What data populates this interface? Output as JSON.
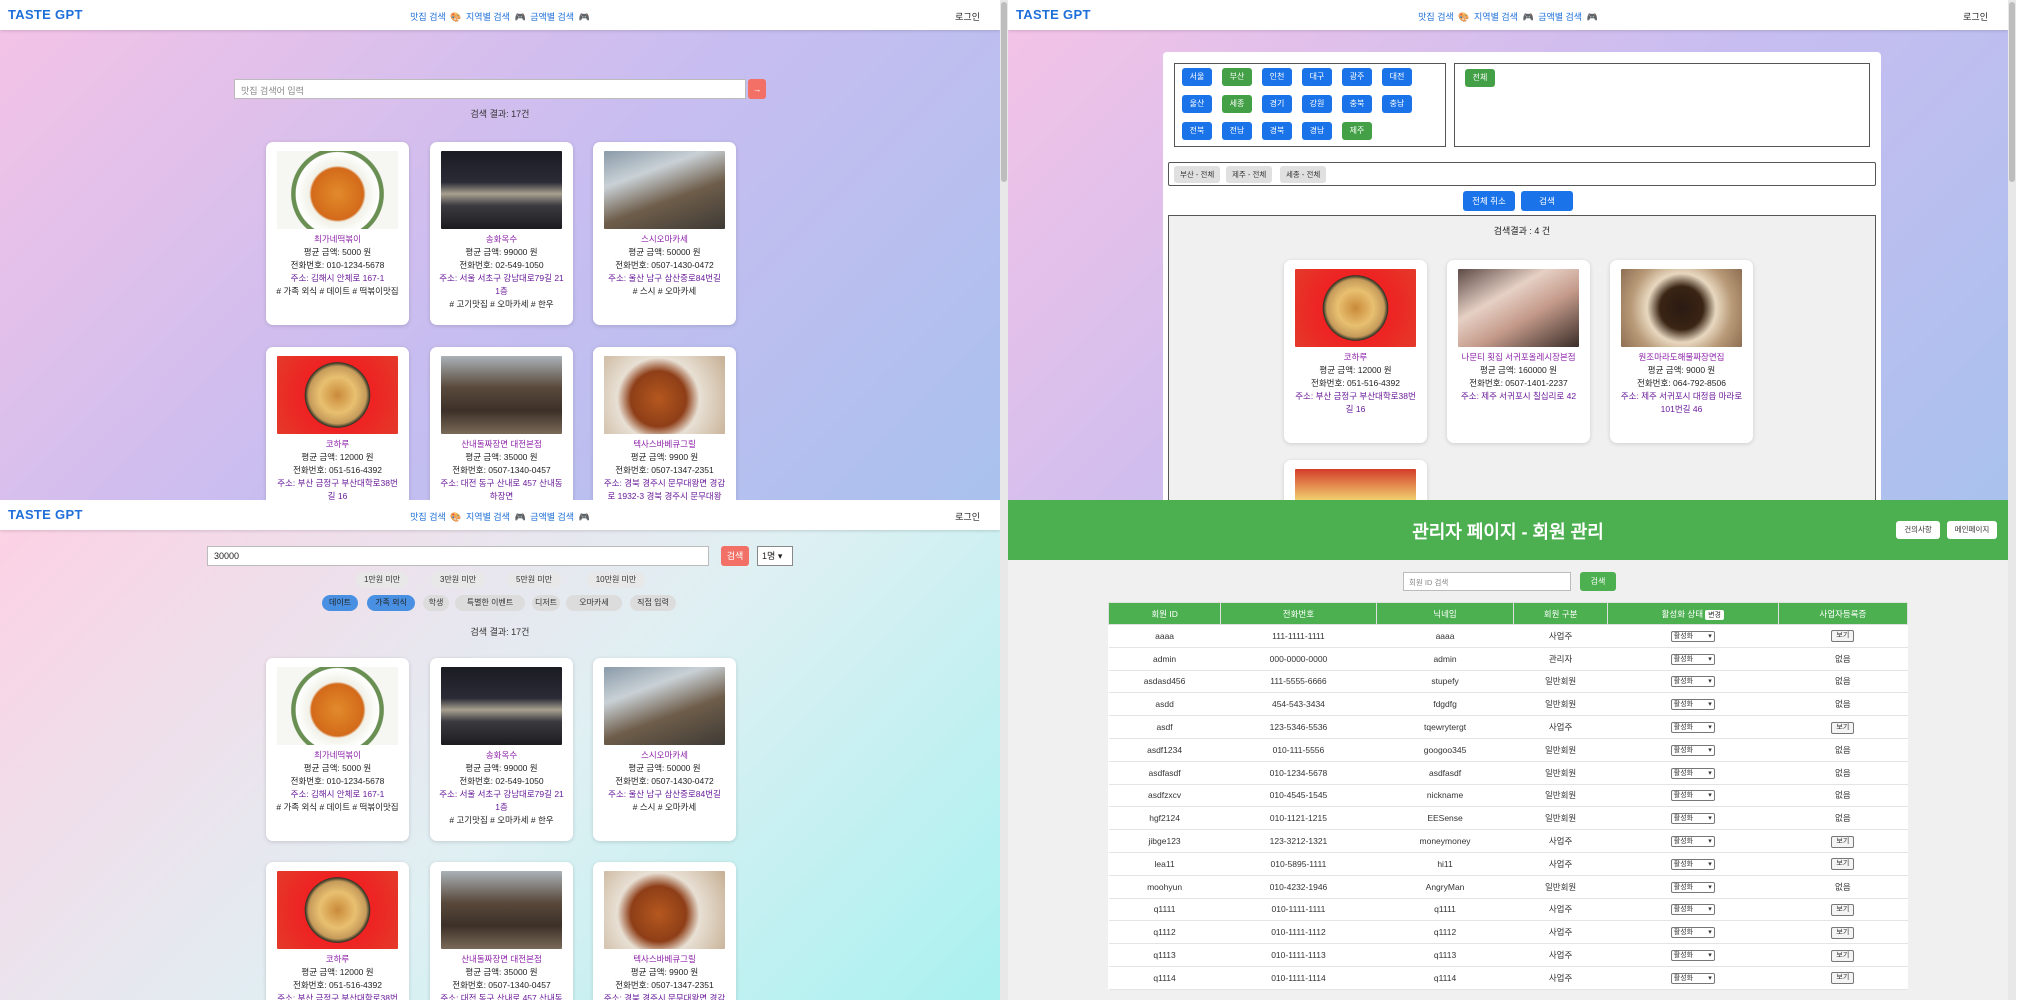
{
  "header": {
    "logo": "TASTE GPT",
    "nav": [
      "맛집 검색",
      "🎨",
      "지역별 검색",
      "🎮",
      "금액별 검색",
      "🎮"
    ],
    "login": "로그인"
  },
  "q1": {
    "search_placeholder": "맛집 검색어 입력",
    "go": "→",
    "count": "검색 결과: 17건"
  },
  "restaurants": [
    {
      "name": "최가네떡볶이",
      "price": "평균 금액: 5000 원",
      "phone": "전화번호: 010-1234-5678",
      "addr": "주소: 김해시 안체로 167-1",
      "tags": "# 가족 외식 # 데이트 # 떡볶이맛집",
      "img": "food1"
    },
    {
      "name": "송화옥수",
      "price": "평균 금액: 99000 원",
      "phone": "전화번호: 02-549-1050",
      "addr": "주소: 서울 서초구 강남대로79길 21 1층",
      "tags": "# 고기맛집 # 오마카세 # 한우",
      "img": "bldg"
    },
    {
      "name": "스시오마카세",
      "price": "평균 금액: 50000 원",
      "phone": "전화번호: 0507-1430-0472",
      "addr": "주소: 울산 남구 삼산중로84번길",
      "tags": "# 스시 # 오마카세",
      "img": "rest"
    },
    {
      "name": "코하루",
      "price": "평균 금액: 12000 원",
      "phone": "전화번호: 051-516-4392",
      "addr": "주소: 부산 금정구 부산대학로38번길 16",
      "tags": "",
      "img": "ramen"
    },
    {
      "name": "산내돌짜장면 대전본점",
      "price": "평균 금액: 35000 원",
      "phone": "전화번호: 0507-1340-0457",
      "addr": "주소: 대전 동구 산내로 457 산내동하장면",
      "tags": "",
      "img": "people"
    },
    {
      "name": "텍사스바베큐그릴",
      "price": "평균 금액: 9900 원",
      "phone": "전화번호: 0507-1347-2351",
      "addr": "주소: 경북 경주시 문무대왕면 경감로 1932-3 경북 경주시 문무대왕",
      "tags": "",
      "img": "meat"
    }
  ],
  "q2": {
    "regions": [
      "서울",
      "부산",
      "인천",
      "대구",
      "광주",
      "대전",
      "울산",
      "세종",
      "경기",
      "강원",
      "충북",
      "충남",
      "전북",
      "전남",
      "경북",
      "경남",
      "제주"
    ],
    "region_selected": [
      "부산",
      "세종",
      "제주"
    ],
    "sub_all": "전체",
    "chips": [
      "부산 - 전체",
      "제주 - 전체",
      "세종 - 전체"
    ],
    "cancel_all": "전체 취소",
    "search": "검색",
    "count": "검색결과 : 4 건",
    "results": [
      {
        "name": "코하루",
        "price": "평균 금액: 12000 원",
        "phone": "전화번호: 051-516-4392",
        "addr": "주소: 부산 금정구 부산대학로38번길 16",
        "img": "ramen"
      },
      {
        "name": "나문티 횟집 서귀포올레시장본점",
        "price": "평균 금액: 160000 원",
        "phone": "전화번호: 0507-1401-2237",
        "addr": "주소: 제주 서귀포시 칠십리로 42",
        "img": "sashimi"
      },
      {
        "name": "원조마라도해물짜장면집",
        "price": "평균 금액: 9000 원",
        "phone": "전화번호: 064-792-8506",
        "addr": "주소: 제주 서귀포시 대정읍 마라로101번길 46",
        "img": "jjajang"
      }
    ]
  },
  "q3": {
    "search_value": "30000",
    "search": "검색",
    "people": "1명",
    "price_filters": [
      "1만원 미만",
      "3만원 미만",
      "5만원 미만",
      "10만원 미만"
    ],
    "tags": [
      "데이트",
      "가족 외식",
      "학생",
      "특별한 이벤트",
      "디저트",
      "오마카세",
      "직접 입력"
    ],
    "tags_active": [
      "데이트",
      "가족 외식"
    ],
    "count": "검색 결과: 17건"
  },
  "admin": {
    "title": "관리자 페이지 - 회원 관리",
    "btn_notice": "건의사항",
    "btn_main": "메인페이지",
    "search_placeholder": "회원 ID 검색",
    "search": "검색",
    "columns": [
      "회원 ID",
      "전화번호",
      "닉네임",
      "회원 구분",
      "활성화 상태",
      "사업자등록증"
    ],
    "edit": "변경",
    "rows": [
      [
        "aaaa",
        "111-1111-1111",
        "aaaa",
        "사업주",
        "활성화",
        "보기"
      ],
      [
        "admin",
        "000-0000-0000",
        "admin",
        "관리자",
        "활성화",
        "없음"
      ],
      [
        "asdasd456",
        "111-5555-6666",
        "stupefy",
        "일반회원",
        "활성화",
        "없음"
      ],
      [
        "asdd",
        "454-543-3434",
        "fdgdfg",
        "일반회원",
        "활성화",
        "없음"
      ],
      [
        "asdf",
        "123-5346-5536",
        "tqewrytergt",
        "사업주",
        "활성화",
        "보기"
      ],
      [
        "asdf1234",
        "010-111-5556",
        "googoo345",
        "일반회원",
        "활성화",
        "없음"
      ],
      [
        "asdfasdf",
        "010-1234-5678",
        "asdfasdf",
        "일반회원",
        "활성화",
        "없음"
      ],
      [
        "asdfzxcv",
        "010-4545-1545",
        "nickname",
        "일반회원",
        "활성화",
        "없음"
      ],
      [
        "hgf2124",
        "010-1121-1215",
        "EESense",
        "일반회원",
        "활성화",
        "없음"
      ],
      [
        "jibge123",
        "123-3212-1321",
        "moneymoney",
        "사업주",
        "활성화",
        "보기"
      ],
      [
        "lea11",
        "010-5895-1111",
        "hi11",
        "사업주",
        "활성화",
        "보기"
      ],
      [
        "moohyun",
        "010-4232-1946",
        "AngryMan",
        "일반회원",
        "활성화",
        "없음"
      ],
      [
        "q1111",
        "010-1111-1111",
        "q1111",
        "사업주",
        "활성화",
        "보기"
      ],
      [
        "q1112",
        "010-1111-1112",
        "q1112",
        "사업주",
        "활성화",
        "보기"
      ],
      [
        "q1113",
        "010-1111-1113",
        "q1113",
        "사업주",
        "활성화",
        "보기"
      ],
      [
        "q1114",
        "010-1111-1114",
        "q1114",
        "사업주",
        "활성화",
        "보기"
      ]
    ]
  }
}
